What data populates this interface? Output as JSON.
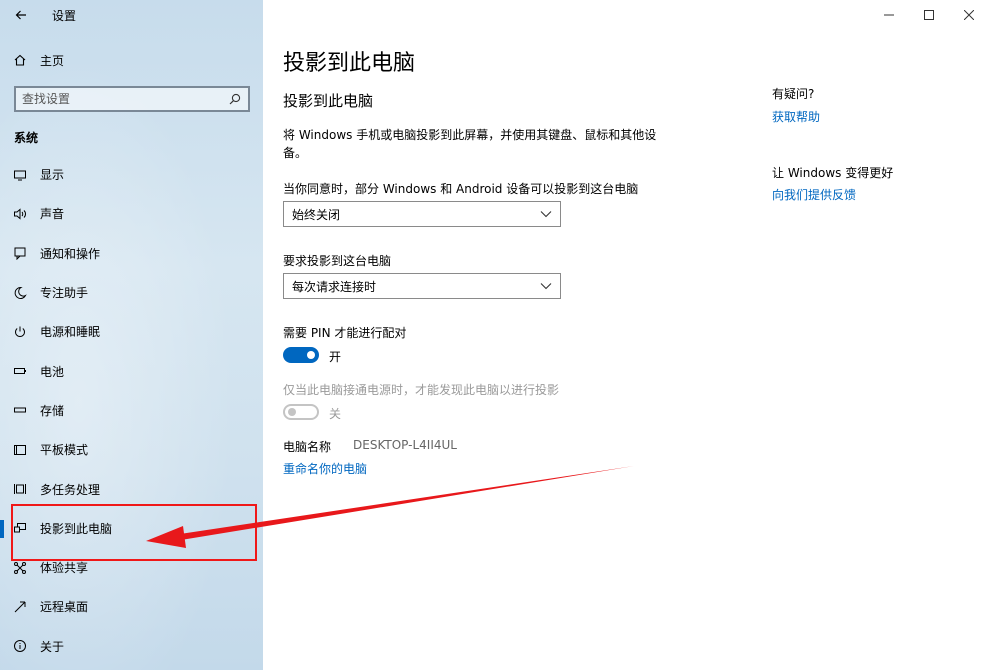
{
  "app": {
    "title": "设置"
  },
  "sidebar": {
    "home_label": "主页",
    "search_placeholder": "查找设置",
    "section_label": "系统",
    "items": [
      {
        "label": "显示",
        "icon": "monitor-icon"
      },
      {
        "label": "声音",
        "icon": "speaker-icon"
      },
      {
        "label": "通知和操作",
        "icon": "notification-icon"
      },
      {
        "label": "专注助手",
        "icon": "moon-icon"
      },
      {
        "label": "电源和睡眠",
        "icon": "power-icon"
      },
      {
        "label": "电池",
        "icon": "battery-icon"
      },
      {
        "label": "存储",
        "icon": "storage-icon"
      },
      {
        "label": "平板模式",
        "icon": "tablet-icon"
      },
      {
        "label": "多任务处理",
        "icon": "multitask-icon"
      },
      {
        "label": "投影到此电脑",
        "icon": "projection-icon"
      },
      {
        "label": "体验共享",
        "icon": "share-icon"
      },
      {
        "label": "远程桌面",
        "icon": "remote-desktop-icon"
      },
      {
        "label": "关于",
        "icon": "info-icon"
      }
    ],
    "selected_index": 9
  },
  "main": {
    "page_title": "投影到此电脑",
    "sub_title": "投影到此电脑",
    "description": "将 Windows 手机或电脑投影到此屏幕，并使用其键盘、鼠标和其他设备。",
    "setting1": {
      "label": "当你同意时，部分 Windows 和 Android 设备可以投影到这台电脑",
      "value": "始终关闭"
    },
    "setting2": {
      "label": "要求投影到这台电脑",
      "value": "每次请求连接时"
    },
    "pin": {
      "label": "需要 PIN 才能进行配对",
      "state": "开"
    },
    "power": {
      "label": "仅当此电脑接通电源时，才能发现此电脑以进行投影",
      "state": "关"
    },
    "pc_name": {
      "label": "电脑名称",
      "value": "DESKTOP-L4II4UL"
    },
    "rename_link": "重命名你的电脑"
  },
  "help": {
    "question_title": "有疑问?",
    "help_link": "获取帮助",
    "improve_title": "让 Windows 变得更好",
    "feedback_link": "向我们提供反馈"
  },
  "colors": {
    "accent": "#0067c0",
    "annotation": "#f01818"
  }
}
